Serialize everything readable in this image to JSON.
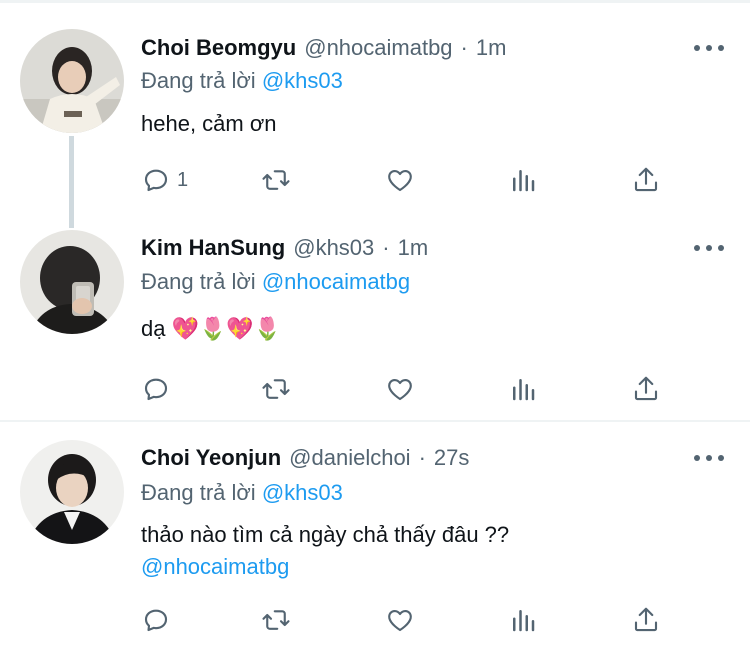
{
  "colors": {
    "link": "#1d9bf0",
    "secondary": "#536471",
    "text": "#0f1419",
    "divider": "#eff3f4"
  },
  "tweets": [
    {
      "name": "Choi Beomgyu",
      "handle": "@nhocaimatbg",
      "dot": "·",
      "time": "1m",
      "replying_prefix": "Đang trả lời",
      "replying_to": "@khs03",
      "text": "hehe, cảm ơn",
      "reply_count": "1",
      "icons": [
        "reply-icon",
        "retweet-icon",
        "like-icon",
        "views-icon",
        "share-icon"
      ]
    },
    {
      "name": "Kim HanSung",
      "handle": "@khs03",
      "dot": "·",
      "time": "1m",
      "replying_prefix": "Đang trả lời",
      "replying_to": "@nhocaimatbg",
      "text": "dạ 💖🌷💖🌷",
      "reply_count": "",
      "icons": [
        "reply-icon",
        "retweet-icon",
        "like-icon",
        "views-icon",
        "share-icon"
      ]
    },
    {
      "name": "Choi Yeonjun",
      "handle": "@danielchoi",
      "dot": "·",
      "time": "27s",
      "replying_prefix": "Đang trả lời",
      "replying_to": "@khs03",
      "text": "thảo nào tìm cả ngày chả thấy đâu ??",
      "text_mention": "@nhocaimatbg",
      "reply_count": "",
      "icons": [
        "reply-icon",
        "retweet-icon",
        "like-icon",
        "views-icon",
        "share-icon"
      ]
    }
  ]
}
